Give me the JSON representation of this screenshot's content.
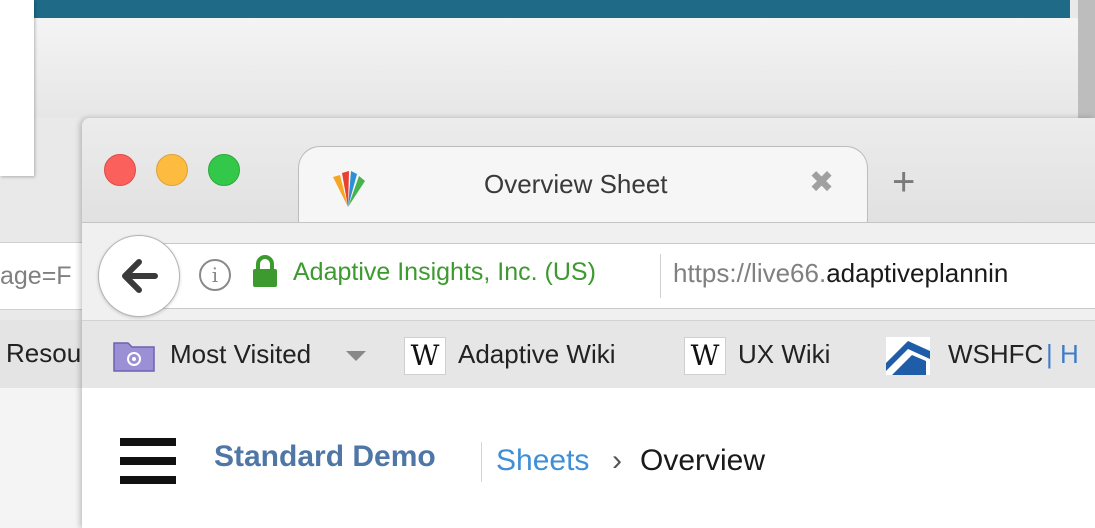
{
  "background_window": {
    "url_fragment": "age=F",
    "bookmark_fragment": "Resou"
  },
  "tab": {
    "title": "Overview Sheet",
    "close_glyph": "✖",
    "new_tab_glyph": "+"
  },
  "navbar": {
    "identity": "Adaptive Insights, Inc. (US)",
    "url_prefix": "https://live66.",
    "url_domain": "adaptiveplannin"
  },
  "bookmarks": [
    {
      "label": "Most Visited",
      "icon": "folder-icon"
    },
    {
      "label": "Adaptive Wiki",
      "icon": "wiki-icon"
    },
    {
      "label": "UX Wiki",
      "icon": "wiki-icon"
    },
    {
      "label": "WSHFC",
      "icon": "wshfc-icon"
    }
  ],
  "bookmark_overflow": "| H",
  "content": {
    "app_name": "Standard Demo",
    "crumb_sheets": "Sheets",
    "crumb_chevron": "›",
    "crumb_current": "Overview"
  },
  "colors": {
    "identity_green": "#3c9a2e",
    "app_name_blue": "#4e76a6",
    "link_blue": "#3f8fd6"
  }
}
